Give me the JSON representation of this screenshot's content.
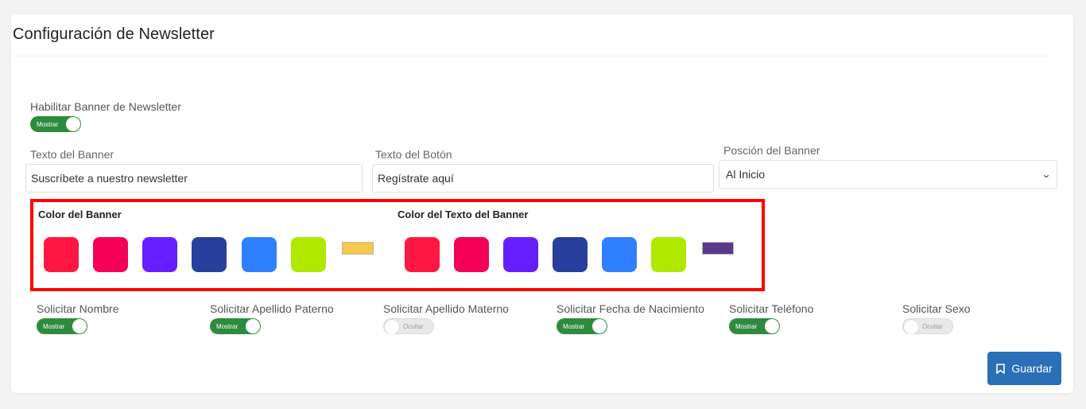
{
  "card": {
    "title": "Configuración de Newsletter"
  },
  "enable": {
    "label": "Habilitar Banner de Newsletter",
    "toggle": "Mostrar"
  },
  "fields": {
    "banner_text": {
      "label": "Texto del Banner",
      "value": "Suscríbete a nuestro newsletter"
    },
    "button_text": {
      "label": "Texto del Botón",
      "value": "Regístrate aquí"
    },
    "position": {
      "label": "Posción del Banner",
      "value": "Al Inicio"
    }
  },
  "colors": {
    "banner_title": "Color del Banner",
    "text_title": "Color del Texto del Banner",
    "banner_swatches": [
      "#ff1744",
      "#f50057",
      "#651fff",
      "#283f9b",
      "#2f80ff",
      "#b0e800",
      "#f5c94a"
    ],
    "text_swatches": [
      "#ff1744",
      "#f50057",
      "#651fff",
      "#283f9b",
      "#2f80ff",
      "#b0e800",
      "#5a3a8a"
    ],
    "highlight": "#ff0000"
  },
  "requests": [
    {
      "label": "Solicitar Nombre",
      "toggle": "Mostrar",
      "on": true
    },
    {
      "label": "Solicitar Apellido Paterno",
      "toggle": "Mostrar",
      "on": true
    },
    {
      "label": "Solicitar Apellido Materno",
      "toggle": "Ocultar",
      "on": false
    },
    {
      "label": "Solicitar Fecha de Nacimiento",
      "toggle": "Mostrar",
      "on": true
    },
    {
      "label": "Solicitar Teléfono",
      "toggle": "Mostrar",
      "on": true
    },
    {
      "label": "Solicitar Sexo",
      "toggle": "Ocultar",
      "on": false
    }
  ],
  "save": {
    "label": "Guardar",
    "icon": "bookmark-icon",
    "color": "#2b6fb6"
  },
  "accent": "#2e8b3e"
}
